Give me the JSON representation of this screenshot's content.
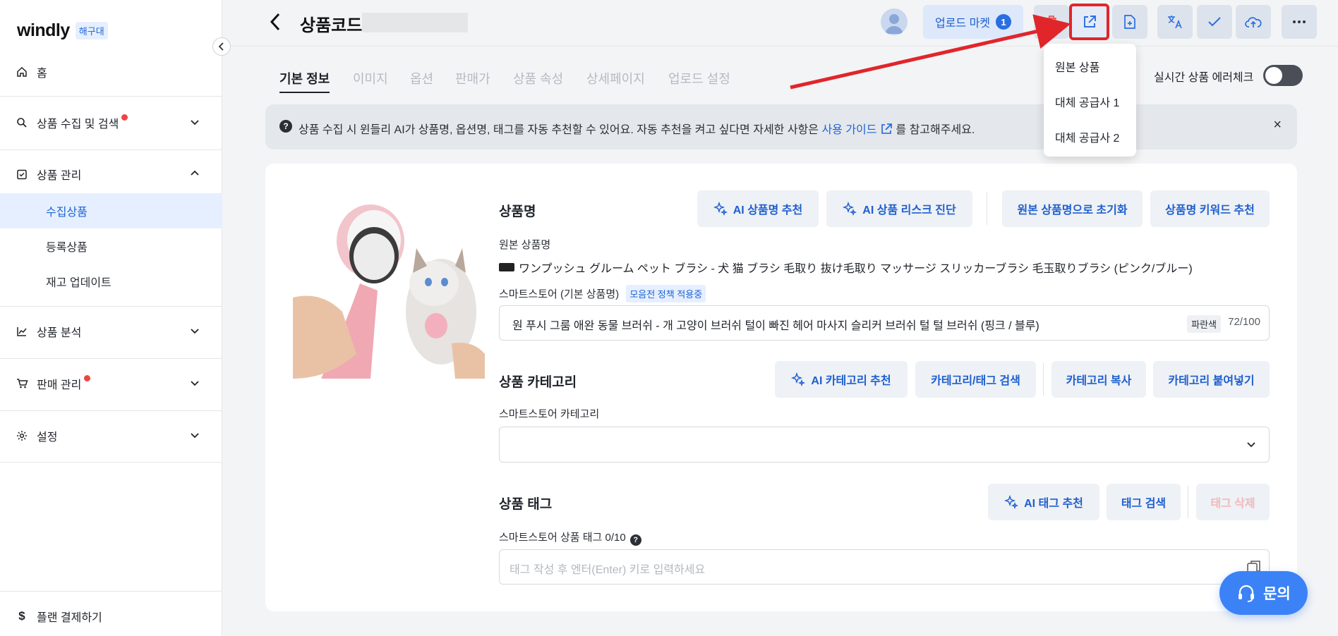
{
  "sidebar": {
    "logo": "windly",
    "logo_badge": "해구대",
    "items": [
      {
        "label": "홈"
      },
      {
        "label": "상품 수집 및 검색"
      },
      {
        "label": "상품 관리"
      },
      {
        "label": "수집상품"
      },
      {
        "label": "등록상품"
      },
      {
        "label": "재고 업데이트"
      },
      {
        "label": "상품 분석"
      },
      {
        "label": "판매 관리"
      },
      {
        "label": "설정"
      }
    ],
    "footer": "플랜 결제하기"
  },
  "header": {
    "title": "상품코드",
    "upload_market_label": "업로드 마켓",
    "upload_market_count": "1"
  },
  "dropdown": {
    "items": [
      "원본 상품",
      "대체 공급사 1",
      "대체 공급사 2"
    ]
  },
  "tabs": [
    "기본 정보",
    "이미지",
    "옵션",
    "판매가",
    "상품 속성",
    "상세페이지",
    "업로드 설정"
  ],
  "realtime_check_label": "실시간 상품 에러체크",
  "notice": {
    "text_before": "상품 수집 시 윈들리 AI가 상품명, 옵션명, 태그를 자동 추천할 수 있어요. 자동 추천을 켜고 싶다면 자세한 사항은",
    "link": "사용 가이드",
    "text_after": "를 참고해주세요."
  },
  "product_name": {
    "title": "상품명",
    "buttons": [
      "AI 상품명 추천",
      "AI 상품 리스크 진단",
      "원본 상품명으로 초기화",
      "상품명 키워드 추천"
    ],
    "original_label": "원본 상품명",
    "original_value": "ワンプッシュ グルーム ペット ブラシ - 犬 猫 ブラシ 毛取り 抜け毛取り マッサージ スリッカーブラシ 毛玉取りブラシ (ピンク/ブルー)",
    "store_label": "스마트스토어 (기본 상품명)",
    "policy_badge": "모음전 정책 적용중",
    "value": "원 푸시 그룸 애완 동물 브러쉬 - 개 고양이 브러쉬 털이 빠진 헤어 마사지 슬리커 브러쉬 털 털 브러쉬 (핑크 / 블루)",
    "color_tag": "파란색",
    "counter": "72/100"
  },
  "category": {
    "title": "상품 카테고리",
    "buttons": [
      "AI 카테고리 추천",
      "카테고리/태그 검색",
      "카테고리 복사",
      "카테고리 붙여넣기"
    ],
    "store_label": "스마트스토어 카테고리"
  },
  "tags": {
    "title": "상품 태그",
    "buttons": [
      "AI 태그 추천",
      "태그 검색",
      "태그 삭제"
    ],
    "store_label": "스마트스토어 상품 태그 0/10",
    "placeholder": "태그 작성 후 엔터(Enter) 키로 입력하세요"
  },
  "inquiry_label": "문의",
  "colors": {
    "accent": "#1e64d6",
    "annotation": "#e0262b"
  }
}
